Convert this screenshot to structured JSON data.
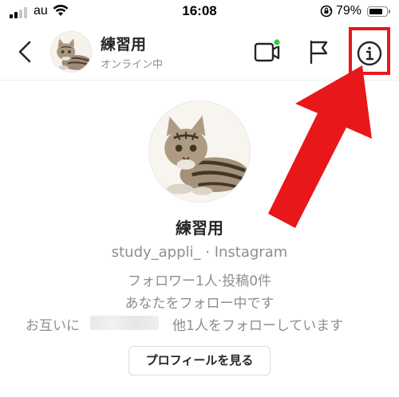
{
  "status_bar": {
    "carrier": "au",
    "time": "16:08",
    "battery_percent": "79%",
    "battery_level": 0.79,
    "icons": [
      "signal-icon",
      "wifi-icon",
      "orientation-lock-icon",
      "battery-icon"
    ]
  },
  "header": {
    "name": "練習用",
    "status": "オンライン中",
    "online_indicator_color": "#2ecc40",
    "icons": [
      "back-chevron-icon",
      "video-call-icon",
      "flag-icon",
      "info-icon"
    ]
  },
  "annotation": {
    "highlight_color": "#e8171a",
    "icons": [
      "red-arrow-icon"
    ]
  },
  "profile": {
    "name": "練習用",
    "handle": "study_appli_ · Instagram",
    "stats": "フォロワー1人·投稿0件",
    "following_you": "あなたをフォロー中です",
    "mutual_prefix": "お互いに",
    "mutual_suffix": "他1人をフォローしています",
    "view_profile_label": "プロフィールを見る"
  }
}
